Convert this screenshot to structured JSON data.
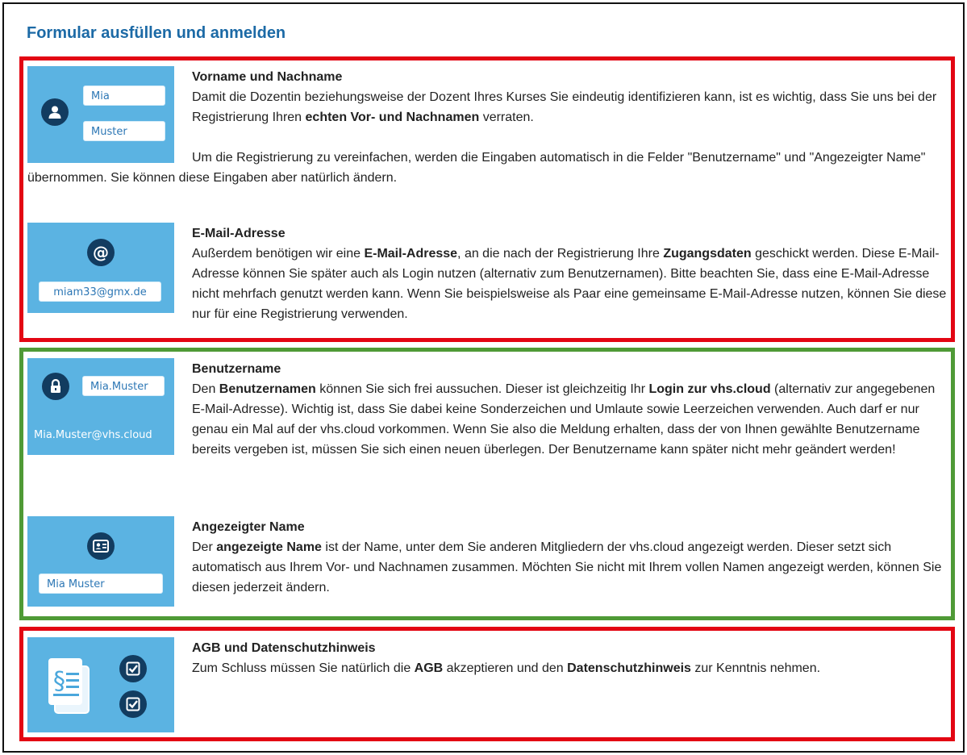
{
  "page": {
    "title": "Formular ausfüllen und anmelden"
  },
  "colors": {
    "title": "#1c6aa6",
    "thumb_bg": "#5bb3e2",
    "icon_circle": "#123c60",
    "red_border": "#e30613",
    "green_border": "#4f9a36"
  },
  "sections": {
    "name": {
      "heading": "Vorname und Nachname",
      "illustration": {
        "first": "Mia",
        "last": "Muster",
        "icon": "person-icon"
      },
      "p1": [
        "Damit die Dozentin beziehungsweise der Dozent Ihres Kurses Sie eindeutig identifizieren kann, ist es wichtig, dass Sie uns bei der Registrierung Ihren ",
        "echten Vor- und Nachnamen",
        " verraten."
      ],
      "p2": "Um die Registrierung zu vereinfachen, werden die Eingaben automatisch in die Felder \"Benutzername\" und \"Angezeigter Name\" übernommen. Sie können diese Eingaben aber natürlich ändern."
    },
    "email": {
      "heading": "E-Mail-Adresse",
      "illustration": {
        "email": "miam33@gmx.de",
        "icon": "at-icon"
      },
      "p1": [
        "Außerdem benötigen wir eine ",
        "E-Mail-Adresse",
        ", an die nach der Registrierung Ihre ",
        "Zugangsdaten",
        " geschickt werden. Diese E-Mail-Adresse können Sie später auch als Login nutzen (alternativ zum Benutzernamen). Bitte beachten Sie, dass eine E-Mail-Adresse nicht mehrfach genutzt werden kann. Wenn Sie beispielsweise als Paar eine gemeinsame E-Mail-Adresse nutzen, können Sie diese nur für eine Registrierung verwenden."
      ]
    },
    "username": {
      "heading": "Benutzername",
      "illustration": {
        "username": "Mia.Muster",
        "login": "Mia.Muster@vhs.cloud",
        "icon": "lock-icon"
      },
      "p1": [
        "Den ",
        "Benutzernamen",
        " können Sie sich frei aussuchen. Dieser ist gleichzeitig Ihr ",
        "Login zur vhs.cloud",
        " (alternativ zur angegebenen E-Mail-Adresse). Wichtig ist, dass Sie dabei keine Sonderzeichen und Umlaute sowie Leerzeichen verwenden. Auch darf er nur genau ein Mal auf der vhs.cloud vorkommen. Wenn Sie also die Meldung erhalten, dass der von Ihnen gewählte Benutzername bereits vergeben ist, müssen Sie sich einen neuen überlegen. Der Benutzername kann später nicht mehr geändert werden!"
      ]
    },
    "display": {
      "heading": "Angezeigter Name",
      "illustration": {
        "display": "Mia Muster",
        "icon": "id-card-icon"
      },
      "p1": [
        "Der ",
        "angezeigte Name",
        " ist der Name, unter dem Sie anderen Mitgliedern der vhs.cloud angezeigt werden. Dieser setzt sich automatisch aus Ihrem Vor- und Nachnamen zusammen. Möchten Sie nicht mit Ihrem vollen Namen angezeigt werden, können Sie diesen jederzeit ändern."
      ]
    },
    "agb": {
      "heading": "AGB und Datenschutzhinweis",
      "illustration": {
        "icon": "document-paragraph-icon",
        "check_icon": "checkbox-icon"
      },
      "p1": [
        "Zum Schluss müssen Sie natürlich die ",
        "AGB",
        " akzeptieren und den ",
        "Datenschutzhinweis",
        " zur Kenntnis nehmen."
      ]
    }
  }
}
